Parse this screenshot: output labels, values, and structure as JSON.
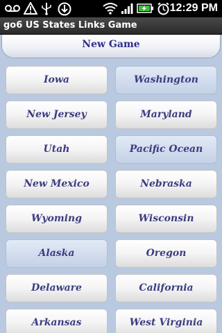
{
  "status_bar": {
    "time": "12:29 PM",
    "icons": [
      "voicemail-icon",
      "warning-icon",
      "usb-icon",
      "download-icon",
      "wifi-icon",
      "signal-icon",
      "battery-charging-icon",
      "alarm-icon"
    ]
  },
  "app": {
    "title": "go6 US States Links Game"
  },
  "new_game": {
    "label": "New Game"
  },
  "grid": {
    "rows": [
      {
        "left": {
          "label": "Iowa",
          "state": "plain"
        },
        "right": {
          "label": "Washington",
          "state": "tinted"
        }
      },
      {
        "left": {
          "label": "New Jersey",
          "state": "plain"
        },
        "right": {
          "label": "Maryland",
          "state": "plain"
        }
      },
      {
        "left": {
          "label": "Utah",
          "state": "plain"
        },
        "right": {
          "label": "Pacific Ocean",
          "state": "tinted"
        }
      },
      {
        "left": {
          "label": "New Mexico",
          "state": "plain"
        },
        "right": {
          "label": "Nebraska",
          "state": "plain"
        }
      },
      {
        "left": {
          "label": "Wyoming",
          "state": "plain"
        },
        "right": {
          "label": "Wisconsin",
          "state": "plain"
        }
      },
      {
        "left": {
          "label": "Alaska",
          "state": "tinted"
        },
        "right": {
          "label": "Oregon",
          "state": "plain"
        }
      },
      {
        "left": {
          "label": "Delaware",
          "state": "plain"
        },
        "right": {
          "label": "California",
          "state": "plain"
        }
      },
      {
        "left": {
          "label": "Arkansas",
          "state": "plain"
        },
        "right": {
          "label": "West Virginia",
          "state": "plain"
        }
      }
    ]
  }
}
